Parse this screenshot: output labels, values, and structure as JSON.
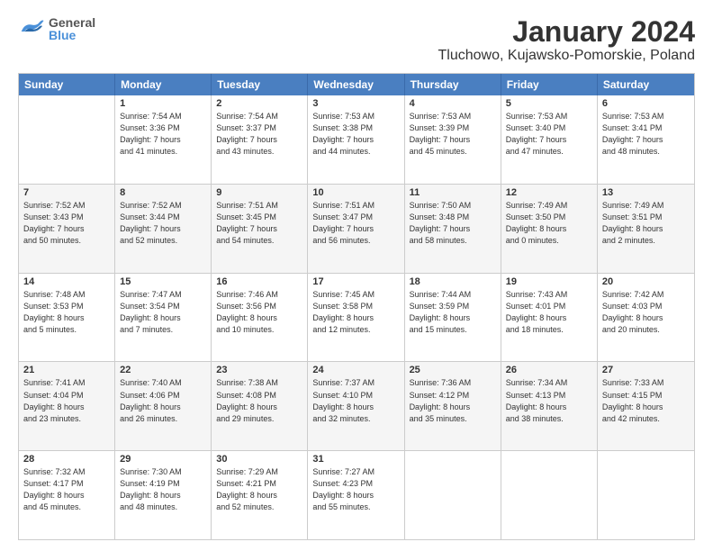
{
  "header": {
    "logo_general": "General",
    "logo_blue": "Blue",
    "title": "January 2024",
    "subtitle": "Tluchowo, Kujawsko-Pomorskie, Poland"
  },
  "days": [
    "Sunday",
    "Monday",
    "Tuesday",
    "Wednesday",
    "Thursday",
    "Friday",
    "Saturday"
  ],
  "weeks": [
    [
      {
        "day": "",
        "info": ""
      },
      {
        "day": "1",
        "info": "Sunrise: 7:54 AM\nSunset: 3:36 PM\nDaylight: 7 hours\nand 41 minutes."
      },
      {
        "day": "2",
        "info": "Sunrise: 7:54 AM\nSunset: 3:37 PM\nDaylight: 7 hours\nand 43 minutes."
      },
      {
        "day": "3",
        "info": "Sunrise: 7:53 AM\nSunset: 3:38 PM\nDaylight: 7 hours\nand 44 minutes."
      },
      {
        "day": "4",
        "info": "Sunrise: 7:53 AM\nSunset: 3:39 PM\nDaylight: 7 hours\nand 45 minutes."
      },
      {
        "day": "5",
        "info": "Sunrise: 7:53 AM\nSunset: 3:40 PM\nDaylight: 7 hours\nand 47 minutes."
      },
      {
        "day": "6",
        "info": "Sunrise: 7:53 AM\nSunset: 3:41 PM\nDaylight: 7 hours\nand 48 minutes."
      }
    ],
    [
      {
        "day": "7",
        "info": "Sunrise: 7:52 AM\nSunset: 3:43 PM\nDaylight: 7 hours\nand 50 minutes."
      },
      {
        "day": "8",
        "info": "Sunrise: 7:52 AM\nSunset: 3:44 PM\nDaylight: 7 hours\nand 52 minutes."
      },
      {
        "day": "9",
        "info": "Sunrise: 7:51 AM\nSunset: 3:45 PM\nDaylight: 7 hours\nand 54 minutes."
      },
      {
        "day": "10",
        "info": "Sunrise: 7:51 AM\nSunset: 3:47 PM\nDaylight: 7 hours\nand 56 minutes."
      },
      {
        "day": "11",
        "info": "Sunrise: 7:50 AM\nSunset: 3:48 PM\nDaylight: 7 hours\nand 58 minutes."
      },
      {
        "day": "12",
        "info": "Sunrise: 7:49 AM\nSunset: 3:50 PM\nDaylight: 8 hours\nand 0 minutes."
      },
      {
        "day": "13",
        "info": "Sunrise: 7:49 AM\nSunset: 3:51 PM\nDaylight: 8 hours\nand 2 minutes."
      }
    ],
    [
      {
        "day": "14",
        "info": "Sunrise: 7:48 AM\nSunset: 3:53 PM\nDaylight: 8 hours\nand 5 minutes."
      },
      {
        "day": "15",
        "info": "Sunrise: 7:47 AM\nSunset: 3:54 PM\nDaylight: 8 hours\nand 7 minutes."
      },
      {
        "day": "16",
        "info": "Sunrise: 7:46 AM\nSunset: 3:56 PM\nDaylight: 8 hours\nand 10 minutes."
      },
      {
        "day": "17",
        "info": "Sunrise: 7:45 AM\nSunset: 3:58 PM\nDaylight: 8 hours\nand 12 minutes."
      },
      {
        "day": "18",
        "info": "Sunrise: 7:44 AM\nSunset: 3:59 PM\nDaylight: 8 hours\nand 15 minutes."
      },
      {
        "day": "19",
        "info": "Sunrise: 7:43 AM\nSunset: 4:01 PM\nDaylight: 8 hours\nand 18 minutes."
      },
      {
        "day": "20",
        "info": "Sunrise: 7:42 AM\nSunset: 4:03 PM\nDaylight: 8 hours\nand 20 minutes."
      }
    ],
    [
      {
        "day": "21",
        "info": "Sunrise: 7:41 AM\nSunset: 4:04 PM\nDaylight: 8 hours\nand 23 minutes."
      },
      {
        "day": "22",
        "info": "Sunrise: 7:40 AM\nSunset: 4:06 PM\nDaylight: 8 hours\nand 26 minutes."
      },
      {
        "day": "23",
        "info": "Sunrise: 7:38 AM\nSunset: 4:08 PM\nDaylight: 8 hours\nand 29 minutes."
      },
      {
        "day": "24",
        "info": "Sunrise: 7:37 AM\nSunset: 4:10 PM\nDaylight: 8 hours\nand 32 minutes."
      },
      {
        "day": "25",
        "info": "Sunrise: 7:36 AM\nSunset: 4:12 PM\nDaylight: 8 hours\nand 35 minutes."
      },
      {
        "day": "26",
        "info": "Sunrise: 7:34 AM\nSunset: 4:13 PM\nDaylight: 8 hours\nand 38 minutes."
      },
      {
        "day": "27",
        "info": "Sunrise: 7:33 AM\nSunset: 4:15 PM\nDaylight: 8 hours\nand 42 minutes."
      }
    ],
    [
      {
        "day": "28",
        "info": "Sunrise: 7:32 AM\nSunset: 4:17 PM\nDaylight: 8 hours\nand 45 minutes."
      },
      {
        "day": "29",
        "info": "Sunrise: 7:30 AM\nSunset: 4:19 PM\nDaylight: 8 hours\nand 48 minutes."
      },
      {
        "day": "30",
        "info": "Sunrise: 7:29 AM\nSunset: 4:21 PM\nDaylight: 8 hours\nand 52 minutes."
      },
      {
        "day": "31",
        "info": "Sunrise: 7:27 AM\nSunset: 4:23 PM\nDaylight: 8 hours\nand 55 minutes."
      },
      {
        "day": "",
        "info": ""
      },
      {
        "day": "",
        "info": ""
      },
      {
        "day": "",
        "info": ""
      }
    ]
  ]
}
